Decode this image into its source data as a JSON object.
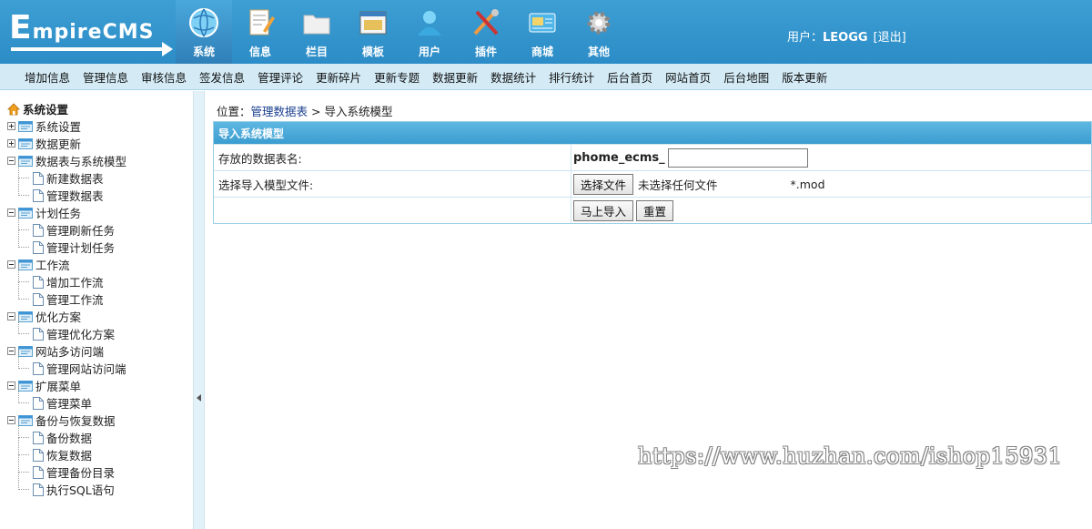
{
  "logo": {
    "first_letter": "E",
    "rest": "mpireCMS"
  },
  "modules": [
    {
      "label": "系统",
      "icon": "globe-icon",
      "active": true
    },
    {
      "label": "信息",
      "icon": "document-edit-icon"
    },
    {
      "label": "栏目",
      "icon": "folder-icon"
    },
    {
      "label": "模板",
      "icon": "window-template-icon"
    },
    {
      "label": "用户",
      "icon": "user-icon"
    },
    {
      "label": "插件",
      "icon": "tools-icon"
    },
    {
      "label": "商城",
      "icon": "shop-card-icon"
    },
    {
      "label": "其他",
      "icon": "gear-icon"
    }
  ],
  "user": {
    "prefix": "用户：",
    "name": "LEOGG",
    "logout": "[退出]"
  },
  "subnav": [
    "增加信息",
    "管理信息",
    "审核信息",
    "签发信息",
    "管理评论",
    "更新碎片",
    "更新专题",
    "数据更新",
    "数据统计",
    "排行统计",
    "后台首页",
    "网站首页",
    "后台地图",
    "版本更新"
  ],
  "tree": {
    "root": "系统设置",
    "groups": [
      {
        "label": "系统设置",
        "collapsed": true,
        "children": []
      },
      {
        "label": "数据更新",
        "collapsed": true,
        "children": []
      },
      {
        "label": "数据表与系统模型",
        "collapsed": false,
        "children": [
          "新建数据表",
          "管理数据表"
        ]
      },
      {
        "label": "计划任务",
        "collapsed": false,
        "children": [
          "管理刷新任务",
          "管理计划任务"
        ]
      },
      {
        "label": "工作流",
        "collapsed": false,
        "children": [
          "增加工作流",
          "管理工作流"
        ]
      },
      {
        "label": "优化方案",
        "collapsed": false,
        "children": [
          "管理优化方案"
        ]
      },
      {
        "label": "网站多访问端",
        "collapsed": false,
        "children": [
          "管理网站访问端"
        ]
      },
      {
        "label": "扩展菜单",
        "collapsed": false,
        "children": [
          "管理菜单"
        ]
      },
      {
        "label": "备份与恢复数据",
        "collapsed": false,
        "children": [
          "备份数据",
          "恢复数据",
          "管理备份目录",
          "执行SQL语句"
        ]
      }
    ]
  },
  "breadcrumb": {
    "prefix": "位置：",
    "link": "管理数据表",
    "sep": " > ",
    "current": "导入系统模型"
  },
  "form": {
    "title": "导入系统模型",
    "table_name_label": "存放的数据表名:",
    "table_prefix": "phome_ecms_",
    "table_name_value": "",
    "file_label": "选择导入模型文件:",
    "choose_file": "选择文件",
    "no_file": "未选择任何文件",
    "extension": "*.mod",
    "submit": "马上导入",
    "reset": "重置"
  },
  "watermark": "https://www.huzhan.com/ishop15931",
  "colors": {
    "header": "#2c8cc7",
    "subnav": "#d4ebf6",
    "table_header": "#3a9dd0"
  }
}
